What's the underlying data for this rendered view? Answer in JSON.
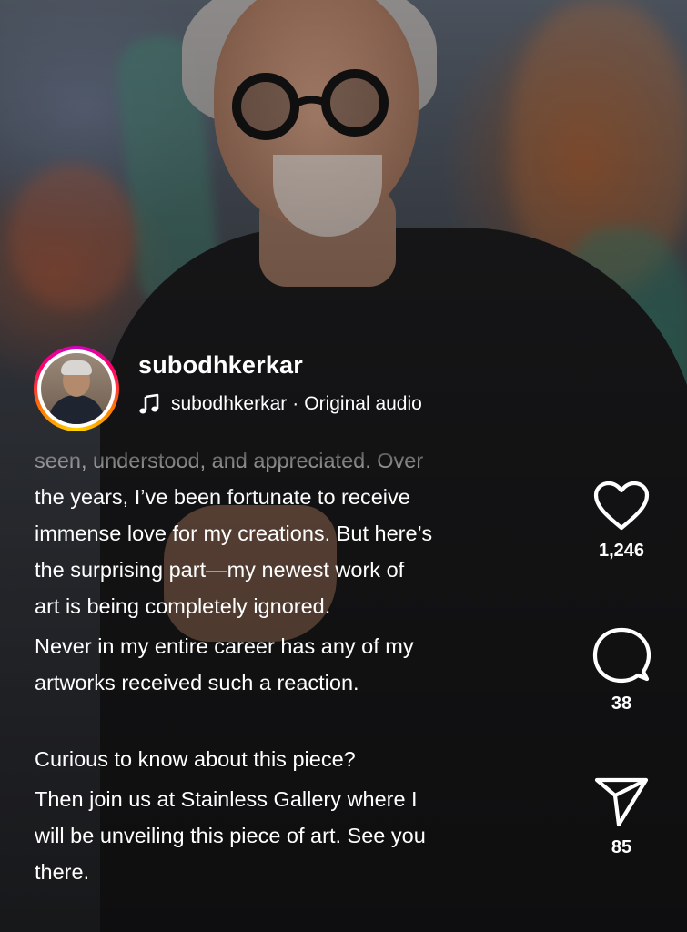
{
  "profile": {
    "username": "subodhkerkar",
    "audio_author": "subodhkerkar",
    "audio_separator": "·",
    "audio_title": "Original audio"
  },
  "caption": {
    "lines": [
      "seen, understood, and appreciated. Over",
      "the years, I’ve been fortunate to receive",
      "immense love for my creations. But here’s",
      "the surprising part—my newest work of",
      "art is being completely ignored.",
      "Never in my entire career has any of my",
      "artworks received such a reaction.",
      "Curious to know about this piece?",
      "Then join us at Stainless Gallery where I",
      "will be unveiling this piece of art. See you",
      "there."
    ]
  },
  "actions": {
    "like_count": "1,246",
    "comment_count": "38",
    "share_count": "85",
    "icons": [
      "heart-icon",
      "comment-icon",
      "share-icon",
      "music-note-icon"
    ]
  },
  "colors": {
    "text": "#ffffff",
    "story_ring": [
      "#d300c5",
      "#ff0069",
      "#ff7a00",
      "#ffd600"
    ]
  }
}
